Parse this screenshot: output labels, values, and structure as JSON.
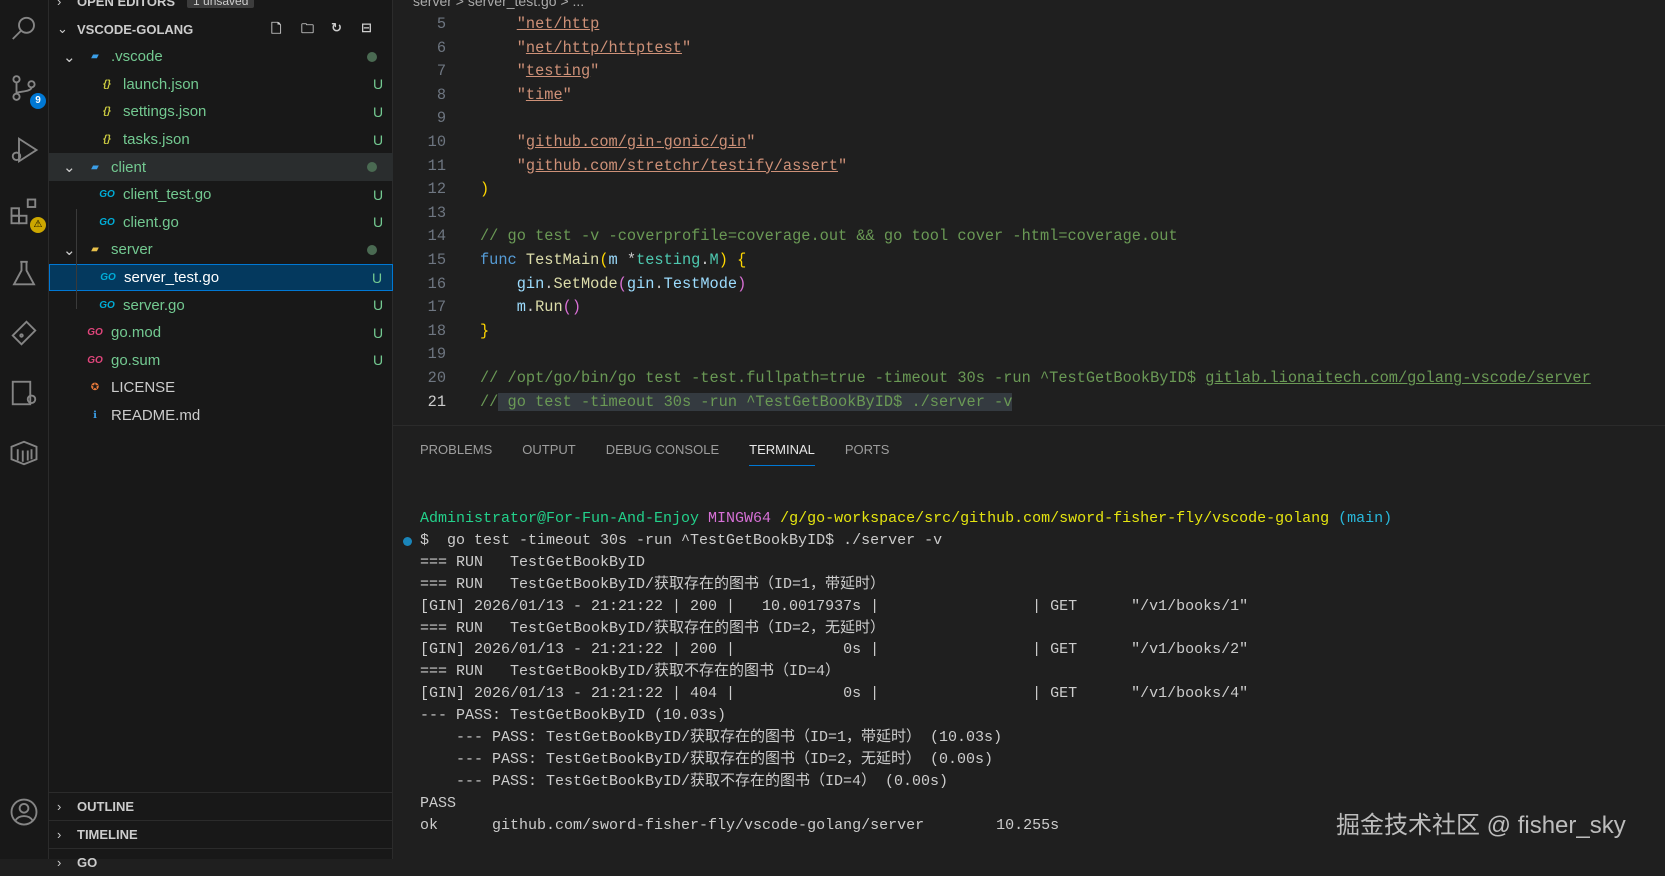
{
  "activity": {
    "scm_badge": "9",
    "ext_badge": "⚠"
  },
  "sidebar": {
    "open_editors": "OPEN EDITORS",
    "unsaved": "1 unsaved",
    "root": "VSCODE-GOLANG",
    "items": [
      {
        "label": ".vscode",
        "icon": "folder-vscode-icon",
        "status": "dot",
        "depth": 1,
        "folder": true
      },
      {
        "label": "launch.json",
        "icon": "json-icon",
        "status": "U",
        "depth": 2
      },
      {
        "label": "settings.json",
        "icon": "json-icon",
        "status": "U",
        "depth": 2
      },
      {
        "label": "tasks.json",
        "icon": "json-icon",
        "status": "U",
        "depth": 2
      },
      {
        "label": "client",
        "icon": "folder-client-icon",
        "status": "dot",
        "depth": 1,
        "folder": true,
        "hover": true
      },
      {
        "label": "client_test.go",
        "icon": "go-file-icon",
        "status": "U",
        "depth": 2
      },
      {
        "label": "client.go",
        "icon": "go-file-icon",
        "status": "U",
        "depth": 2
      },
      {
        "label": "server",
        "icon": "folder-server-icon",
        "status": "dot",
        "depth": 1,
        "folder": true
      },
      {
        "label": "server_test.go",
        "icon": "go-file-icon",
        "status": "U",
        "depth": 2,
        "selected": true
      },
      {
        "label": "server.go",
        "icon": "go-file-icon",
        "status": "U",
        "depth": 2
      },
      {
        "label": "go.mod",
        "icon": "go-mod-icon",
        "status": "U",
        "depth": 1
      },
      {
        "label": "go.sum",
        "icon": "go-mod-icon",
        "status": "U",
        "depth": 1
      },
      {
        "label": "LICENSE",
        "icon": "license-icon",
        "status": "",
        "depth": 1,
        "plain": true
      },
      {
        "label": "README.md",
        "icon": "info-icon",
        "status": "",
        "depth": 1,
        "plain": true
      }
    ],
    "outline": "OUTLINE",
    "timeline": "TIMELINE",
    "go": "GO"
  },
  "editor": {
    "breadcrumb": "server > server_test.go > ...",
    "lines": [
      {
        "n": "5",
        "t": [
          [
            "    ",
            "p"
          ],
          [
            "\"net/http",
            "s"
          ]
        ]
      },
      {
        "n": "6",
        "t": [
          [
            "    \"",
            "sq"
          ],
          [
            "net/http/httptest",
            "s"
          ],
          [
            "\"",
            "sq"
          ]
        ]
      },
      {
        "n": "7",
        "t": [
          [
            "    \"",
            "sq"
          ],
          [
            "testing",
            "s"
          ],
          [
            "\"",
            "sq"
          ]
        ]
      },
      {
        "n": "8",
        "t": [
          [
            "    \"",
            "sq"
          ],
          [
            "time",
            "s"
          ],
          [
            "\"",
            "sq"
          ]
        ]
      },
      {
        "n": "9",
        "t": []
      },
      {
        "n": "10",
        "t": [
          [
            "    \"",
            "sq"
          ],
          [
            "github.com/gin-gonic/gin",
            "s"
          ],
          [
            "\"",
            "sq"
          ]
        ]
      },
      {
        "n": "11",
        "t": [
          [
            "    \"",
            "sq"
          ],
          [
            "github.com/stretchr/testify/assert",
            "s"
          ],
          [
            "\"",
            "sq"
          ]
        ]
      },
      {
        "n": "12",
        "t": [
          [
            ")",
            "b1"
          ]
        ]
      },
      {
        "n": "13",
        "t": []
      },
      {
        "n": "14",
        "t": [
          [
            "// go test -v -coverprofile=coverage.out && go tool cover -html=coverage.out",
            "c"
          ]
        ]
      },
      {
        "n": "15",
        "t": [
          [
            "func ",
            "k"
          ],
          [
            "TestMain",
            "f"
          ],
          [
            "(",
            "b1"
          ],
          [
            "m ",
            "v"
          ],
          [
            "*",
            "p"
          ],
          [
            "testing",
            "t"
          ],
          [
            ".",
            "p"
          ],
          [
            "M",
            "t"
          ],
          [
            ")",
            "b1"
          ],
          [
            " ",
            "p"
          ],
          [
            "{",
            "b1"
          ]
        ]
      },
      {
        "n": "16",
        "t": [
          [
            "    gin",
            "v"
          ],
          [
            ".",
            "p"
          ],
          [
            "SetMode",
            "f"
          ],
          [
            "(",
            "b2"
          ],
          [
            "gin",
            "v"
          ],
          [
            ".",
            "p"
          ],
          [
            "TestMode",
            "v"
          ],
          [
            ")",
            "b2"
          ]
        ]
      },
      {
        "n": "17",
        "t": [
          [
            "    m",
            "v"
          ],
          [
            ".",
            "p"
          ],
          [
            "Run",
            "f"
          ],
          [
            "()",
            "b2"
          ]
        ]
      },
      {
        "n": "18",
        "t": [
          [
            "}",
            "b1"
          ]
        ]
      },
      {
        "n": "19",
        "t": []
      },
      {
        "n": "20",
        "t": [
          [
            "// /opt/go/bin/go test -test.fullpath=true -timeout 30s -run ^TestGetBookByID$ ",
            "c"
          ],
          [
            "gitlab.lionaitech.com/golang-vscode/server",
            "cu"
          ]
        ]
      },
      {
        "n": "21",
        "t": [
          [
            "//",
            "c"
          ],
          [
            " go test -timeout 30s -run ^TestGetBookByID$ ./server -v",
            "hl"
          ]
        ],
        "current": true
      }
    ]
  },
  "panel": {
    "tabs": [
      "PROBLEMS",
      "OUTPUT",
      "DEBUG CONSOLE",
      "TERMINAL",
      "PORTS"
    ],
    "active_tab": "TERMINAL",
    "terminal": [
      [
        [
          "Administrator@For-Fun-And-Enjoy ",
          "tg"
        ],
        [
          "MINGW64 ",
          "tm"
        ],
        [
          "/g/go-workspace/src/github.com/sword-fisher-fly/vscode-golang ",
          "ty"
        ],
        [
          "(main)",
          "tc"
        ]
      ],
      [
        [
          "$  go test -timeout 30s -run ^TestGetBookByID$ ./server -v",
          ""
        ]
      ],
      [
        [
          "=== RUN   TestGetBookByID",
          ""
        ]
      ],
      [
        [
          "=== RUN   TestGetBookByID/获取存在的图书（ID=1，带延时）",
          ""
        ]
      ],
      [
        [
          "[GIN] 2026/01/13 - 21:21:22 | 200 |   10.0017937s |                 | GET      \"/v1/books/1\"",
          ""
        ]
      ],
      [
        [
          "=== RUN   TestGetBookByID/获取存在的图书（ID=2，无延时）",
          ""
        ]
      ],
      [
        [
          "[GIN] 2026/01/13 - 21:21:22 | 200 |            0s |                 | GET      \"/v1/books/2\"",
          ""
        ]
      ],
      [
        [
          "=== RUN   TestGetBookByID/获取不存在的图书（ID=4）",
          ""
        ]
      ],
      [
        [
          "[GIN] 2026/01/13 - 21:21:22 | 404 |            0s |                 | GET      \"/v1/books/4\"",
          ""
        ]
      ],
      [
        [
          "--- PASS: TestGetBookByID (10.03s)",
          ""
        ]
      ],
      [
        [
          "    --- PASS: TestGetBookByID/获取存在的图书（ID=1，带延时） (10.03s)",
          ""
        ]
      ],
      [
        [
          "    --- PASS: TestGetBookByID/获取存在的图书（ID=2，无延时） (0.00s)",
          ""
        ]
      ],
      [
        [
          "    --- PASS: TestGetBookByID/获取不存在的图书（ID=4） (0.00s)",
          ""
        ]
      ],
      [
        [
          "PASS",
          ""
        ]
      ],
      [
        [
          "ok      github.com/sword-fisher-fly/vscode-golang/server        10.255s",
          ""
        ]
      ]
    ]
  },
  "watermark": "掘金技术社区 @ fisher_sky"
}
